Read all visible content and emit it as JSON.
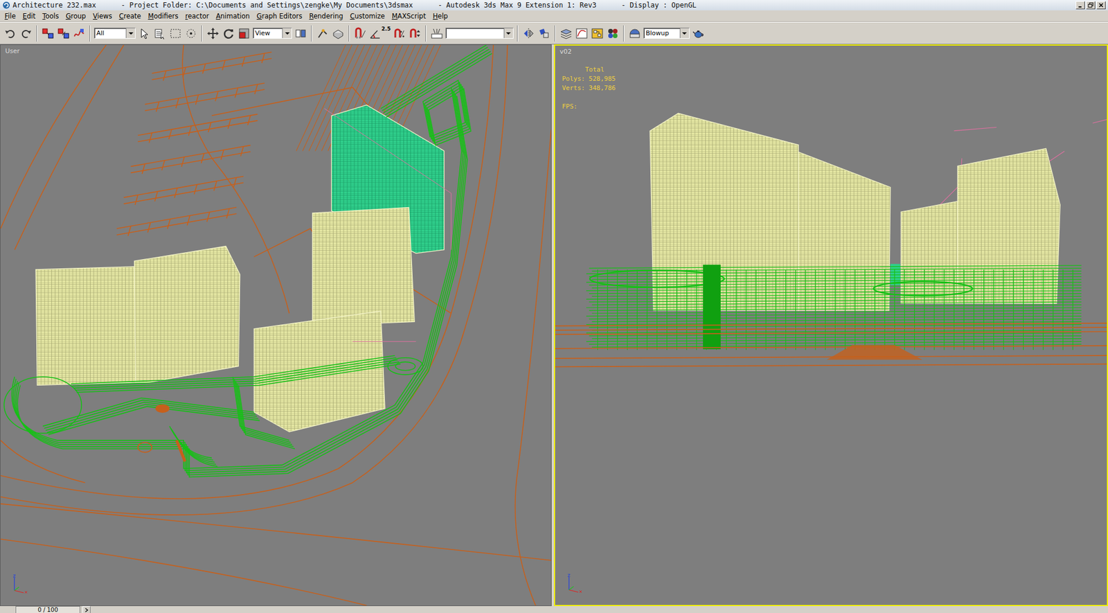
{
  "window": {
    "title": "Architecture 232.max      - Project Folder: C:\\Documents and Settings\\zengke\\My Documents\\3dsmax      - Autodesk 3ds Max 9 Extension 1: Rev3      - Display : OpenGL"
  },
  "menu": [
    "File",
    "Edit",
    "Tools",
    "Group",
    "Views",
    "Create",
    "Modifiers",
    "reactor",
    "Animation",
    "Graph Editors",
    "Rendering",
    "Customize",
    "MAXScript",
    "Help"
  ],
  "toolbar": {
    "selection_filter": "All",
    "coordinate_system": "View",
    "angle_snap": "2.5",
    "render_preset": "Blowup"
  },
  "viewports": [
    {
      "label": "User",
      "selected": false
    },
    {
      "label": "v02",
      "selected": true,
      "stats": {
        "heading": "Total",
        "polys": "Polys: 528,985",
        "verts": "Verts: 348,786",
        "fps": "FPS:"
      }
    }
  ],
  "timeline": {
    "frame": "0 / 100"
  }
}
